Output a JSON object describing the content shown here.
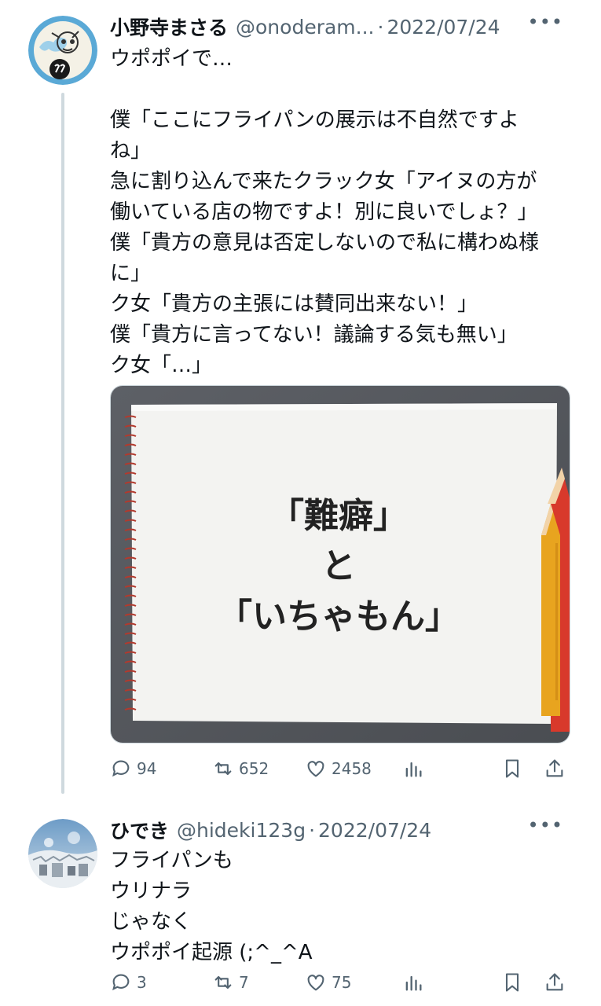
{
  "tweets": [
    {
      "author_name": "小野寺まさる",
      "handle": "@onoderam...",
      "separator": "·",
      "date": "2022/07/24",
      "more_label": "•••",
      "lines": [
        "ウポポイで…",
        "",
        "僕「ここにフライパンの展示は不自然ですよ",
        "ね」",
        "急に割り込んで来たクラック女「アイヌの方が",
        "働いている店の物ですよ！別に良いでしょ？」",
        "僕「貴方の意見は否定しないので私に構わぬ様",
        "に」",
        "ク女「貴方の主張には賛同出来ない！」",
        "僕「貴方に言ってない！議論する気も無い」",
        "ク女「…」"
      ],
      "image": {
        "line1": "「難癖」",
        "line2": "と",
        "line3": "「いちゃもん」"
      },
      "replies": "94",
      "retweets": "652",
      "likes": "2458"
    },
    {
      "author_name": "ひでき",
      "handle": "@hideki123g",
      "separator": "·",
      "date": "2022/07/24",
      "more_label": "•••",
      "lines": [
        "フライパンも",
        "ウリナラ",
        "じゃなく",
        "ウポポイ起源 (;^_^A"
      ],
      "replies": "3",
      "retweets": "7",
      "likes": "75"
    }
  ],
  "icons": [
    "reply-icon",
    "retweet-icon",
    "like-icon",
    "views-icon",
    "bookmark-icon",
    "share-icon",
    "more-icon"
  ],
  "colors": {
    "text": "#0f1419",
    "secondary": "#536471",
    "line": "#cfd9de"
  }
}
